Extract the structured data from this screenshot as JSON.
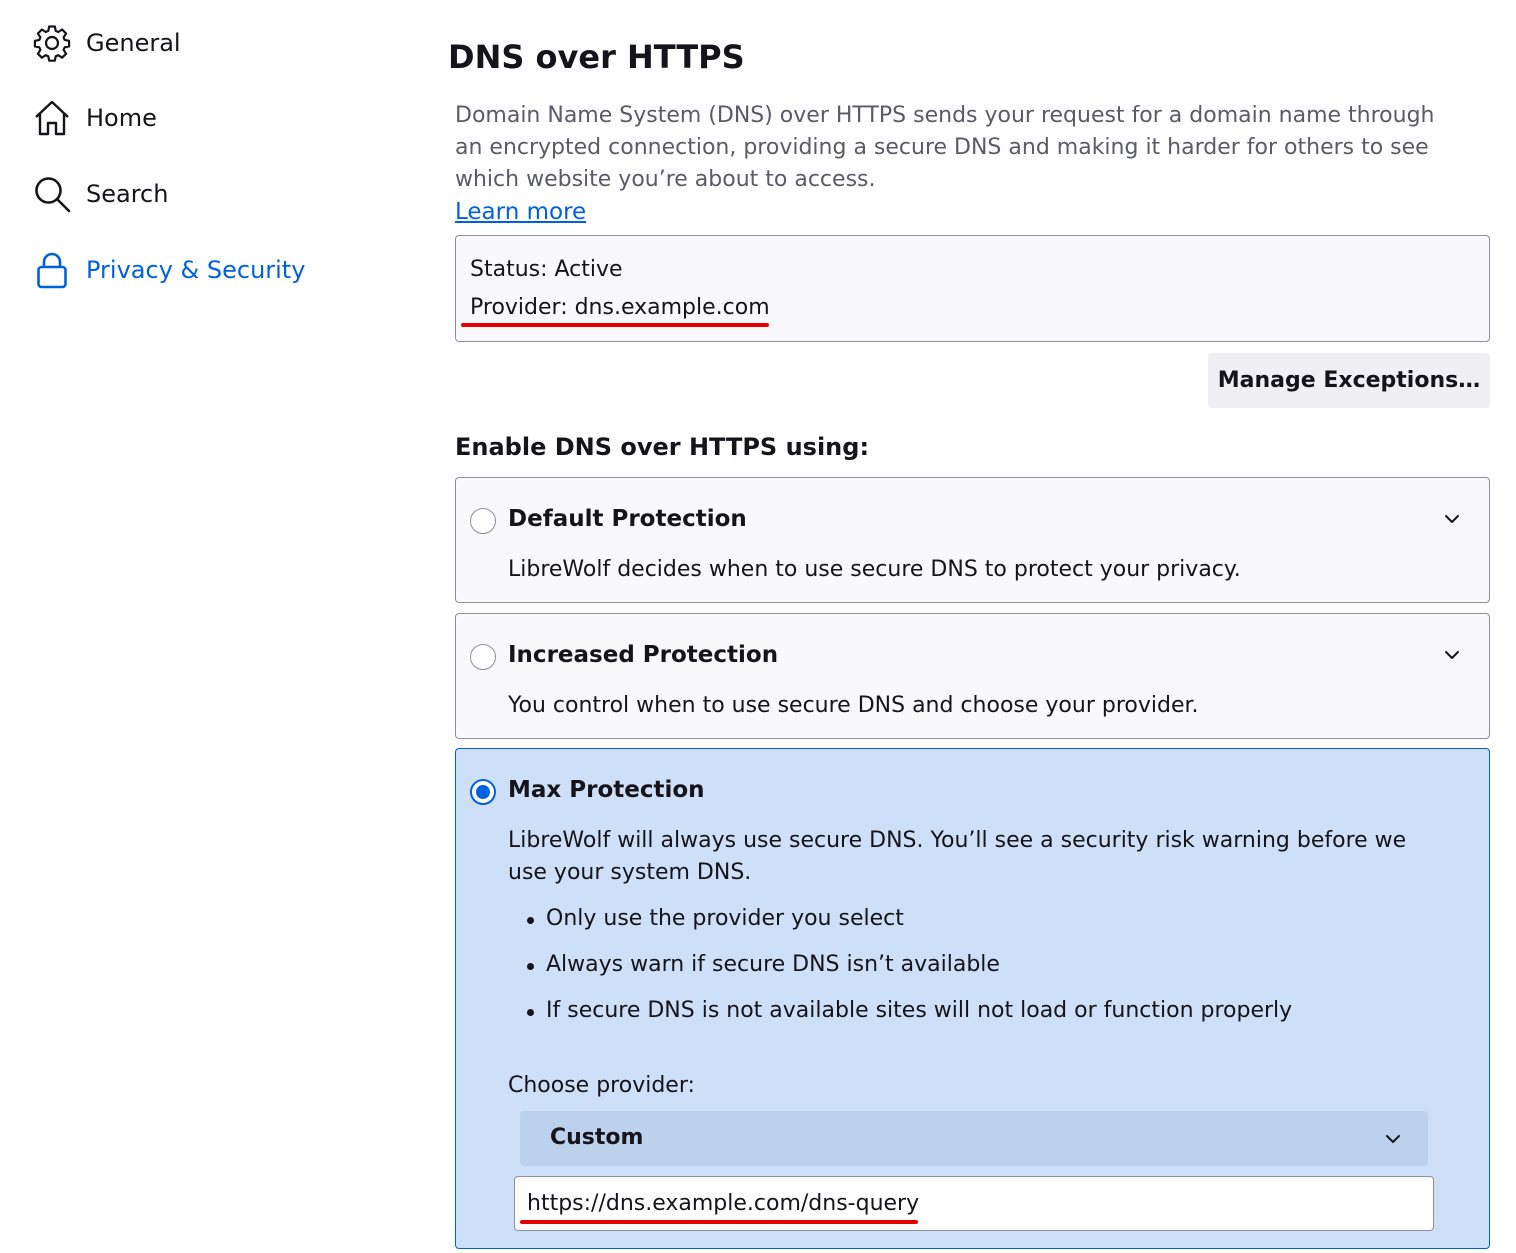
{
  "sidebar": {
    "items": [
      {
        "label": "General",
        "icon": "gear-icon"
      },
      {
        "label": "Home",
        "icon": "home-icon"
      },
      {
        "label": "Search",
        "icon": "search-icon"
      },
      {
        "label": "Privacy & Security",
        "icon": "lock-icon",
        "active": true
      }
    ]
  },
  "main": {
    "title": "DNS over HTTPS",
    "description": "Domain Name System (DNS) over HTTPS sends your request for a domain name through an encrypted connection, providing a secure DNS and making it harder for others to see which website you’re about to access.",
    "learn_more": "Learn more",
    "status": {
      "status_text": "Status: Active",
      "provider_text": "Provider: dns.example.com"
    },
    "manage_exceptions_label": "Manage Exceptions…",
    "enable_heading": "Enable DNS over HTTPS using:",
    "options": [
      {
        "title": "Default Protection",
        "description": "LibreWolf decides when to use secure DNS to protect your privacy.",
        "selected": false
      },
      {
        "title": "Increased Protection",
        "description": "You control when to use secure DNS and choose your provider.",
        "selected": false
      },
      {
        "title": "Max Protection",
        "description": "LibreWolf will always use secure DNS. You’ll see a security risk warning before we use your system DNS.",
        "selected": true,
        "bullets": [
          "Only use the provider you select",
          "Always warn if secure DNS isn’t available",
          "If secure DNS is not available sites will not load or function properly"
        ],
        "choose_provider_label": "Choose provider:",
        "provider_selected": "Custom",
        "custom_url": "https://dns.example.com/dns-query"
      }
    ]
  },
  "colors": {
    "accent": "#0061e0",
    "selected_card_bg": "#cde0f8",
    "annotation_red": "#e60000"
  }
}
